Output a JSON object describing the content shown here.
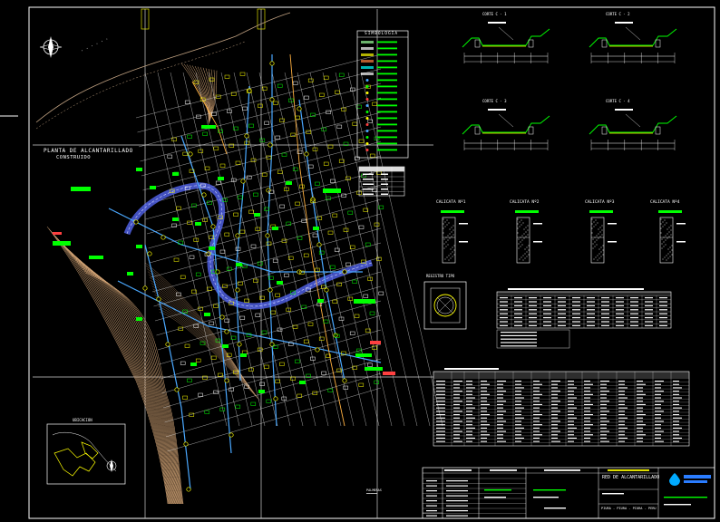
{
  "sheet": {
    "plan_title_line1": "PLANTA DE ALCANTARILLADO",
    "plan_title_line2": "CONSTRUIDO",
    "legend_title": "SIMBOLOGIA",
    "location_title": "UBICACION",
    "registro_title": "REGISTRO TIPO",
    "reference_tag": "PALMERAS",
    "sections": [
      "CORTE C - 1",
      "CORTE C - 2",
      "CORTE C - 3",
      "CORTE C - 4"
    ],
    "calicatas": [
      "CALICATA Nº1",
      "CALICATA Nº2",
      "CALICATA Nº3",
      "CALICATA Nº4"
    ],
    "title_block_project": "RED DE ALCANTARILLADO",
    "title_block_location": "PIURA - PIURA - PIURA - PERU"
  },
  "colors": {
    "background": "#000000",
    "frame": "#ffffff",
    "contours": "#d8a878",
    "grid": "#ffffff",
    "pipes": "#4aa8ff",
    "road": "#5a6cff",
    "labels": "#00ff00",
    "yellow": "#ffff00",
    "cyan": "#00e5ff"
  }
}
